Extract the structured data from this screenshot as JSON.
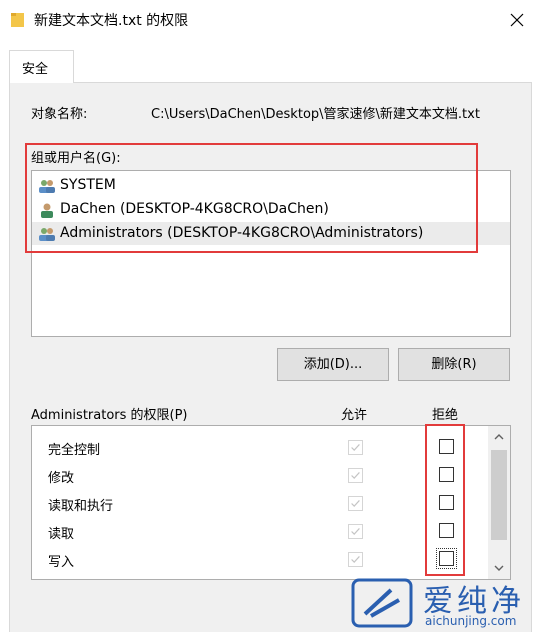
{
  "window": {
    "title": "新建文本文档.txt 的权限"
  },
  "tabs": [
    {
      "label": "安全"
    }
  ],
  "object": {
    "label": "对象名称:",
    "path": "C:\\Users\\DaChen\\Desktop\\管家速修\\新建文本文档.txt"
  },
  "groups": {
    "label": "组或用户名(G):",
    "items": [
      {
        "name": "SYSTEM",
        "icon": "users-group-icon",
        "selected": false
      },
      {
        "name": "DaChen (DESKTOP-4KG8CRO\\DaChen)",
        "icon": "user-icon",
        "selected": false
      },
      {
        "name": "Administrators (DESKTOP-4KG8CRO\\Administrators)",
        "icon": "users-group-icon",
        "selected": true
      }
    ]
  },
  "buttons": {
    "add": "添加(D)...",
    "remove": "删除(R)"
  },
  "permissions": {
    "title": "Administrators 的权限(P)",
    "allow_header": "允许",
    "deny_header": "拒绝",
    "rows": [
      {
        "name": "完全控制",
        "allow": true,
        "deny": false
      },
      {
        "name": "修改",
        "allow": true,
        "deny": false
      },
      {
        "name": "读取和执行",
        "allow": true,
        "deny": false
      },
      {
        "name": "读取",
        "allow": true,
        "deny": false
      },
      {
        "name": "写入",
        "allow": true,
        "deny": false
      }
    ]
  },
  "watermark": {
    "text": "爱纯净",
    "url": "aichunjing.com"
  },
  "colors": {
    "highlight": "#e23b3b",
    "watermark": "#2a5fb0"
  }
}
